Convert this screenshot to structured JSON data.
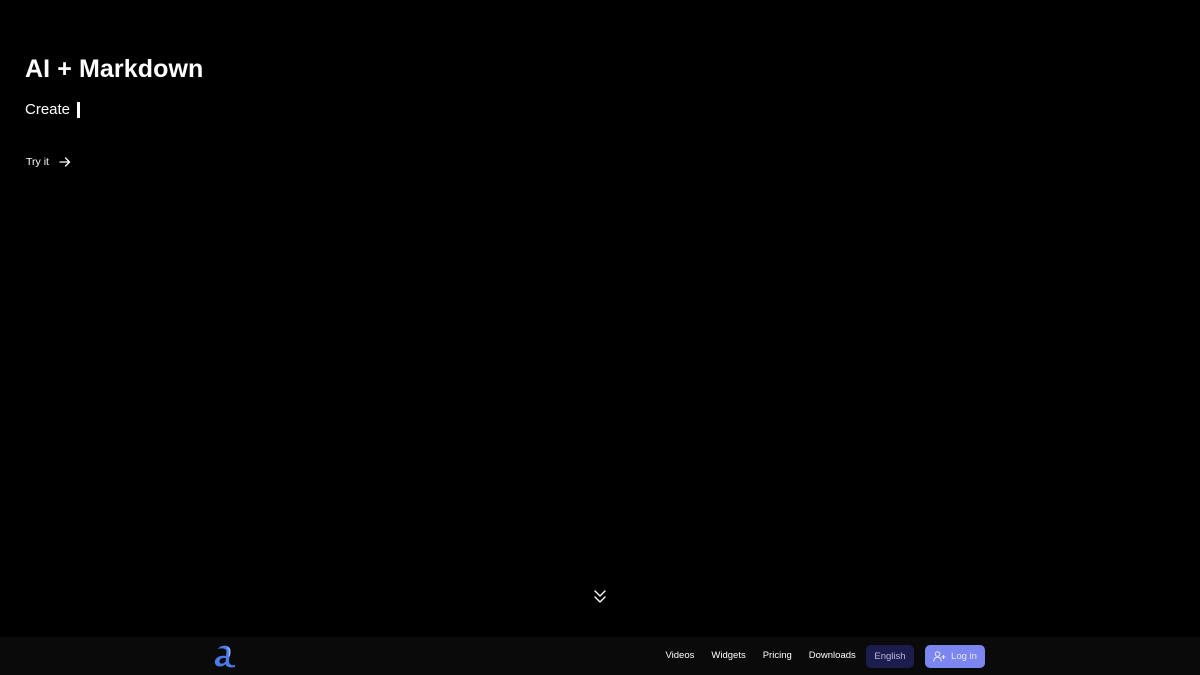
{
  "hero": {
    "title": "AI + Markdown",
    "subtitle": "Create"
  },
  "cta": {
    "label": "Try it",
    "icon": "arrow-right-icon"
  },
  "scroll_indicator": {
    "icon": "double-chevron-down-icon"
  },
  "navbar": {
    "logo_icon": "app-logo-icon",
    "links": [
      "Videos",
      "Widgets",
      "Pricing",
      "Downloads"
    ],
    "language": "English",
    "login": {
      "label": "Log in",
      "icon": "user-plus-icon"
    }
  },
  "colors": {
    "background": "#000000",
    "navbar_background": "#0a0a0a",
    "language_button": "#1c1c4d",
    "login_button": "#7b86f0",
    "logo_blue": "#4a7be8"
  }
}
